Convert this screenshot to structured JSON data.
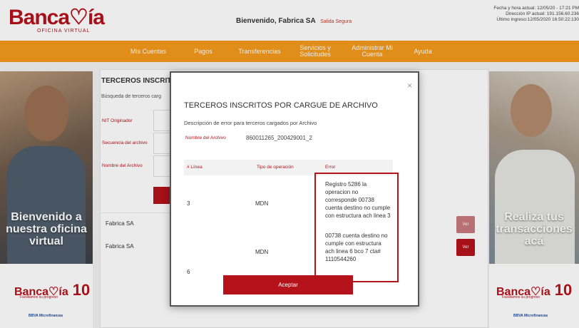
{
  "header": {
    "logo_main": "Banca♡ía",
    "logo_sub": "OFICINA VIRTUAL",
    "welcome": "Bienvenido, Fabrica SA",
    "logout": "Salida Segura",
    "session_lines": [
      "Fecha y hora actual: 12/05/20 - 17:21 PM",
      "Dirección IP actual: 191.156.60.236",
      "Último ingreso:12/05/2020 16:50:22:130"
    ]
  },
  "nav": {
    "items": [
      "Mis Cuentas",
      "Pagos",
      "Transferencias",
      "Servicios y Solicitudes",
      "Administrar Mi Cuenta",
      "Ayuda"
    ]
  },
  "background": {
    "panel_title": "TERCEROS INSCRIT",
    "panel_subtitle": "Búsqueda de terceros carg",
    "labels": [
      "NIT Originador",
      "Secuencia del archivo",
      "Nombre del Archivo"
    ],
    "rows": [
      "Fabrica SA",
      "Fabrica SA"
    ],
    "view_button": "Ver",
    "left_banner_text": "Bienvenido a nuestra oficina virtual",
    "right_banner_text": "Realiza tus transacciones acá",
    "small_logo": "Banca♡ía",
    "small_logo_ten": "10",
    "small_logo_tag": "Facilitamos su progreso",
    "small_org": "BBVA Microfinanzas"
  },
  "modal": {
    "close": "×",
    "title": "TERCEROS INSCRITOS POR CARGUE DE ARCHIVO",
    "description": "Descripción de error para terceros cargados por Archivo",
    "file_label": "Nombre del Archivo",
    "file_name": "860011265_200429001_2",
    "columns": [
      "# Línea",
      "Tipo de operación",
      "Error"
    ],
    "rows": [
      {
        "line": "3",
        "operation": "MDN",
        "error": "Registro 5286 la operacion no corresponde 00738 cuenta destino no cumple con estructura ach linea 3"
      },
      {
        "line": "6",
        "operation": "MDN",
        "error": "00738 cuenta destino no cumple con estructura ach linea 6 bco 7 cta# 1110544260"
      }
    ],
    "accept": "Aceptar"
  },
  "colors": {
    "brand_red": "#b5121b",
    "nav_orange": "#f39a1c"
  }
}
